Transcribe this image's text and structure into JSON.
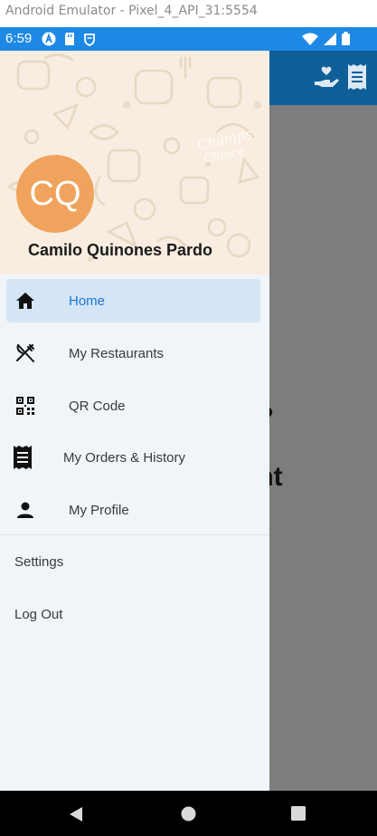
{
  "window": {
    "title": "Android Emulator - Pixel_4_API_31:5554"
  },
  "status_bar": {
    "time": "6:59",
    "left_icons": [
      "a-badge-icon",
      "sd-card-icon",
      "shield-icon"
    ],
    "right_icons": [
      "wifi-icon",
      "signal-icon",
      "battery-icon"
    ],
    "color": "#1e88e5"
  },
  "background_app": {
    "header_color": "#0f5f99",
    "header_icons": [
      "hand-heart-icon",
      "receipt-icon"
    ],
    "partial_text_1": "y?",
    "partial_text_2": "unt"
  },
  "drawer": {
    "avatar_initials": "CQ",
    "avatar_color": "#f0a35c",
    "user_name": "Camilo Quinones Pardo",
    "nav_items": [
      {
        "label": "Home",
        "icon": "home-icon",
        "active": true
      },
      {
        "label": "My Restaurants",
        "icon": "utensils-icon",
        "active": false
      },
      {
        "label": "QR Code",
        "icon": "qr-code-icon",
        "active": false
      },
      {
        "label": "My Orders & History",
        "icon": "receipt-icon",
        "active": false
      },
      {
        "label": "My Profile",
        "icon": "person-icon",
        "active": false
      }
    ],
    "secondary_items": [
      {
        "label": "Settings"
      },
      {
        "label": "Log Out"
      }
    ],
    "active_color": "#1976d2"
  },
  "system_nav": {
    "buttons": [
      "back-icon",
      "home-circle-icon",
      "recents-icon"
    ]
  }
}
